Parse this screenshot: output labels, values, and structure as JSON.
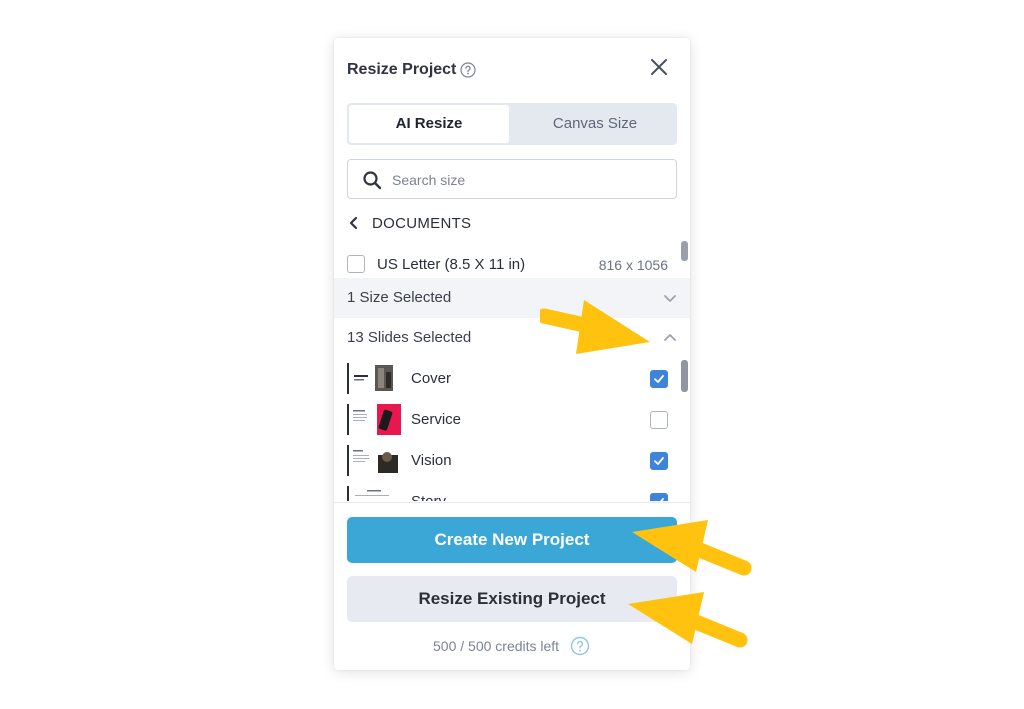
{
  "dialog": {
    "title": "Resize Project",
    "accent_color": "#3ba7d6",
    "icons": [
      "help-icon",
      "close-icon",
      "search-icon",
      "chevron-left-icon",
      "chevron-down-icon",
      "chevron-up-icon",
      "checkmark-icon"
    ]
  },
  "tabs": [
    {
      "label": "AI Resize",
      "active": true
    },
    {
      "label": "Canvas Size",
      "active": false
    }
  ],
  "search": {
    "placeholder": "Search size",
    "value": ""
  },
  "category": {
    "label": "DOCUMENTS"
  },
  "size_option": {
    "name": "US Letter (8.5 X 11 in)",
    "dimensions": "816 x 1056",
    "checked": false
  },
  "sections": {
    "sizes": {
      "label": "1 Size Selected",
      "expanded": false
    },
    "slides": {
      "label": "13 Slides Selected",
      "expanded": true
    }
  },
  "slides": [
    {
      "name": "Cover",
      "checked": true
    },
    {
      "name": "Service",
      "checked": false
    },
    {
      "name": "Vision",
      "checked": true
    },
    {
      "name": "Story",
      "checked": true
    }
  ],
  "buttons": {
    "create": "Create New Project",
    "resize": "Resize Existing Project"
  },
  "credits": {
    "text": "500 / 500 credits left"
  },
  "annotation_color": "#ffc20e"
}
